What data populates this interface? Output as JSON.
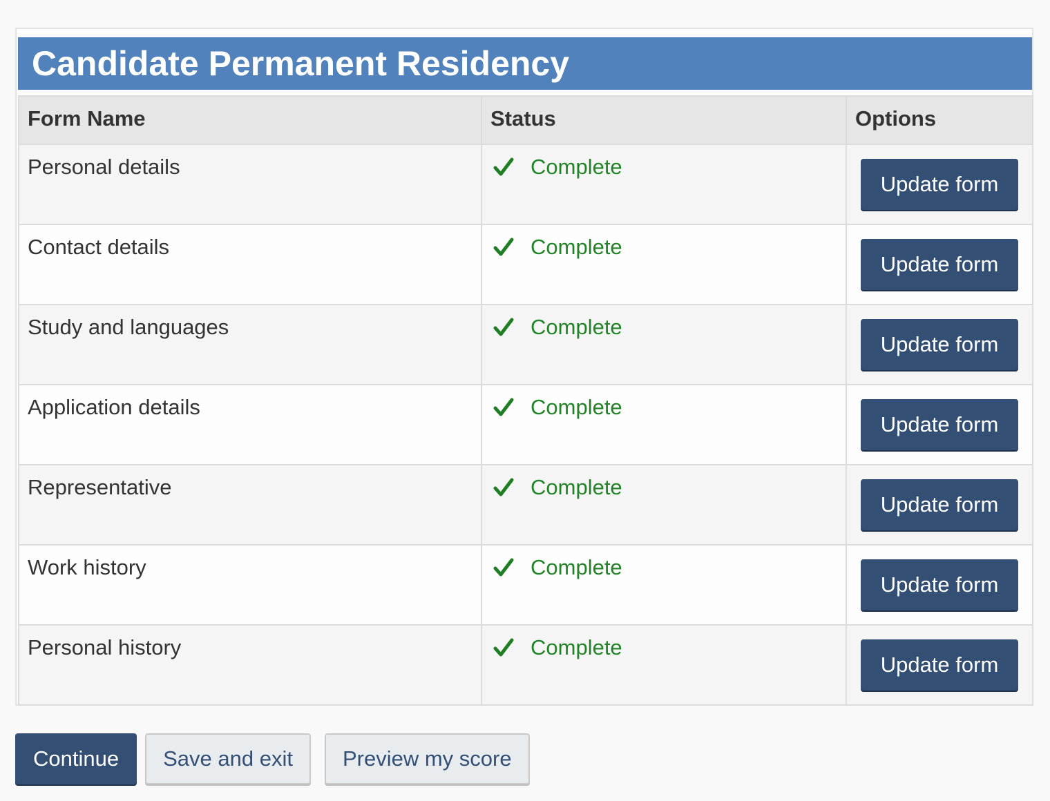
{
  "panel": {
    "title": "Candidate Permanent Residency"
  },
  "table": {
    "headers": {
      "form_name": "Form Name",
      "status": "Status",
      "options": "Options"
    },
    "rows": [
      {
        "name": "Personal details",
        "status": "Complete",
        "action": "Update form"
      },
      {
        "name": "Contact details",
        "status": "Complete",
        "action": "Update form"
      },
      {
        "name": "Study and languages",
        "status": "Complete",
        "action": "Update form"
      },
      {
        "name": "Application details",
        "status": "Complete",
        "action": "Update form"
      },
      {
        "name": "Representative",
        "status": "Complete",
        "action": "Update form"
      },
      {
        "name": "Work history",
        "status": "Complete",
        "action": "Update form"
      },
      {
        "name": "Personal history",
        "status": "Complete",
        "action": "Update form"
      }
    ]
  },
  "actions": {
    "continue_label": "Continue",
    "save_exit_label": "Save and exit",
    "preview_label": "Preview my score"
  },
  "icons": {
    "status_icon": "checkmark-icon"
  },
  "colors": {
    "header_blue": "#5182bb",
    "button_navy": "#344f74",
    "complete_green": "#238427"
  }
}
